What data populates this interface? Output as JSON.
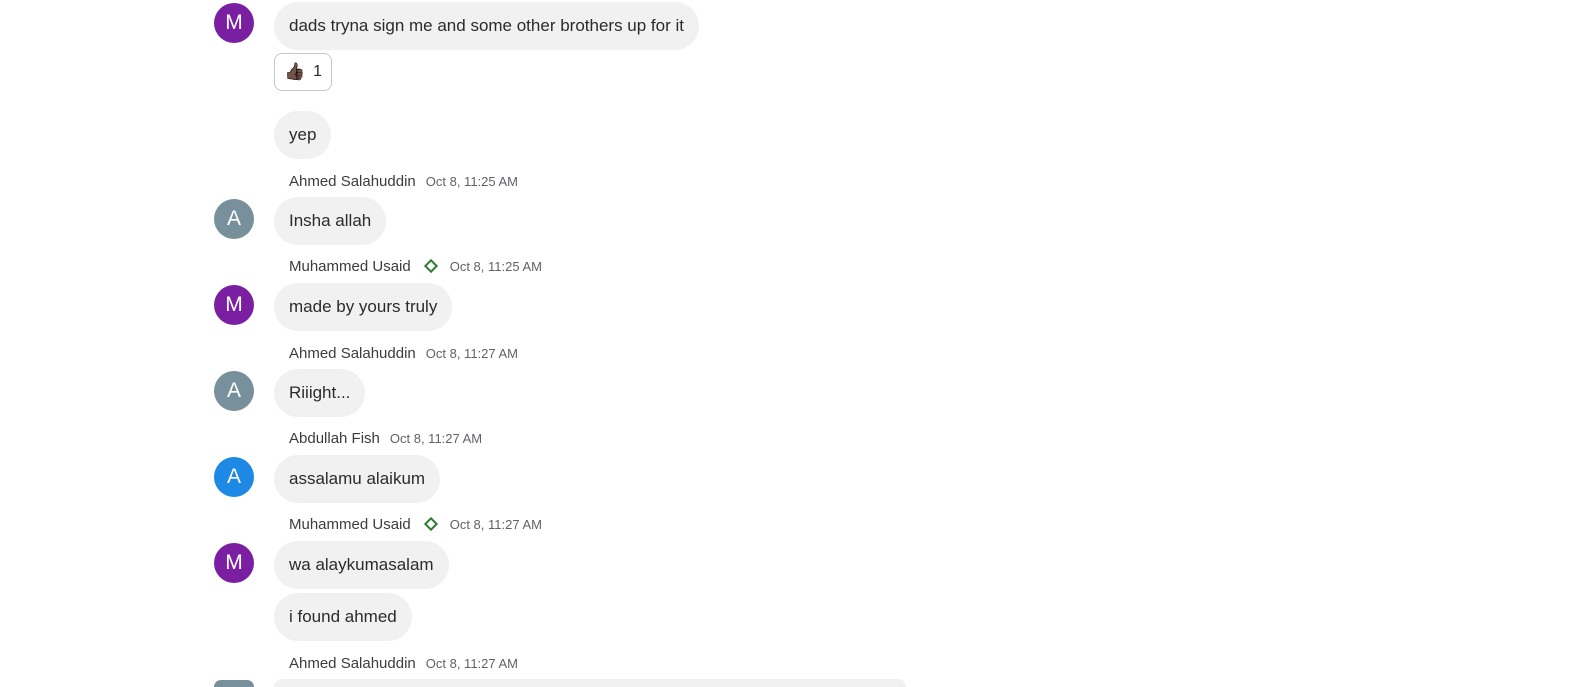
{
  "colors": {
    "avatar_purple": "#7b1fa2",
    "avatar_grey": "#78909c",
    "avatar_blue": "#1e88e5",
    "bubble_bg": "#f1f1f1",
    "verified_green": "#2e7d32"
  },
  "messages": {
    "m1": {
      "avatar": "M",
      "text": "dads tryna sign me and some other brothers up for it"
    },
    "m1_reaction": {
      "emoji": "👍🏿",
      "count": "1"
    },
    "m2": {
      "text": "yep"
    },
    "g3": {
      "sender": "Ahmed Salahuddin",
      "time": "Oct 8, 11:25 AM",
      "avatar": "A",
      "text": "Insha allah"
    },
    "g4": {
      "sender": "Muhammed Usaid",
      "time": "Oct 8, 11:25 AM",
      "avatar": "M",
      "text": "made by yours truly",
      "verified_icon": "diamond-outline-icon"
    },
    "g5": {
      "sender": "Ahmed Salahuddin",
      "time": "Oct 8, 11:27 AM",
      "avatar": "A",
      "text": "Riiight..."
    },
    "g6": {
      "sender": "Abdullah Fish",
      "time": "Oct 8, 11:27 AM",
      "avatar": "A",
      "text": "assalamu alaikum"
    },
    "g7": {
      "sender": "Muhammed Usaid",
      "time": "Oct 8, 11:27 AM",
      "avatar": "M",
      "text": "wa alaykumasalam",
      "text2": "i found ahmed",
      "verified_icon": "diamond-outline-icon"
    },
    "g8": {
      "sender": "Ahmed Salahuddin",
      "time": "Oct 8, 11:27 AM",
      "avatar": "A"
    }
  }
}
